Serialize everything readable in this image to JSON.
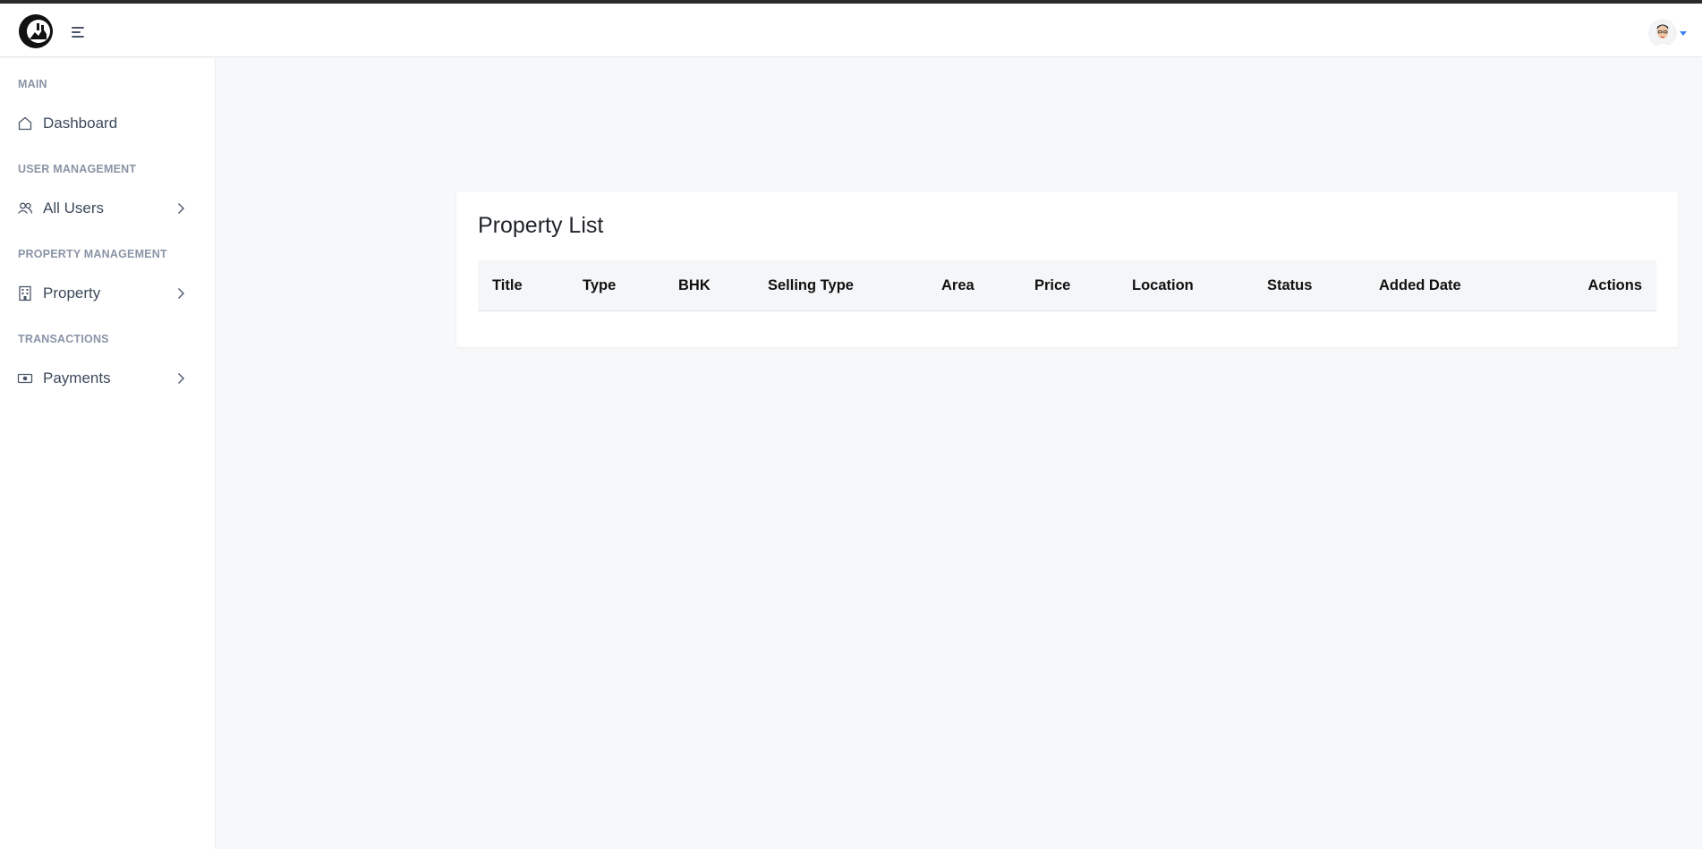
{
  "header": {
    "logo_icon": "company-logo-icon",
    "menu_icon": "hamburger-menu-icon",
    "avatar_icon": "user-avatar-icon"
  },
  "sidebar": {
    "sections": [
      {
        "title": "MAIN",
        "items": [
          {
            "label": "Dashboard",
            "icon": "home-icon",
            "has_submenu": false
          }
        ]
      },
      {
        "title": "USER MANAGEMENT",
        "items": [
          {
            "label": "All Users",
            "icon": "users-icon",
            "has_submenu": true
          }
        ]
      },
      {
        "title": "PROPERTY MANAGEMENT",
        "items": [
          {
            "label": "Property",
            "icon": "building-icon",
            "has_submenu": true
          }
        ]
      },
      {
        "title": "TRANSACTIONS",
        "items": [
          {
            "label": "Payments",
            "icon": "money-icon",
            "has_submenu": true
          }
        ]
      }
    ]
  },
  "main": {
    "card_title": "Property List",
    "table": {
      "columns": [
        "Title",
        "Type",
        "BHK",
        "Selling Type",
        "Area",
        "Price",
        "Location",
        "Status",
        "Added Date",
        "Actions"
      ],
      "rows": []
    }
  },
  "colors": {
    "accent": "#3b82f6",
    "sidebar_text": "#3d4a5c",
    "section_title": "#8a94a6",
    "background": "#f7f8fa"
  }
}
